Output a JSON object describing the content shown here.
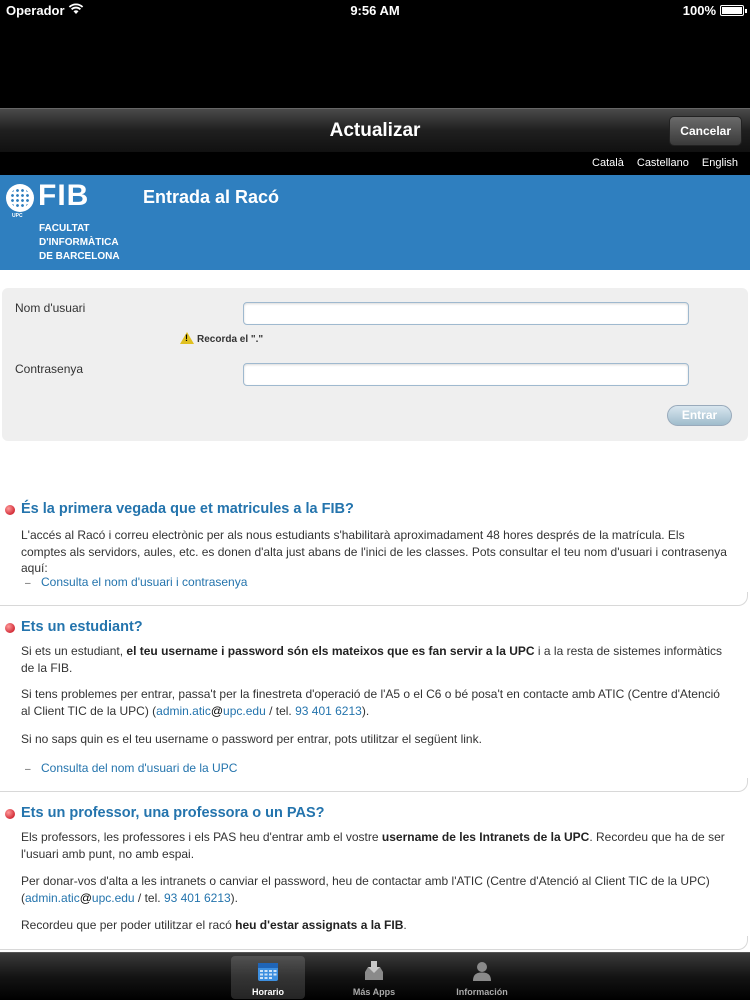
{
  "status_bar": {
    "carrier": "Operador",
    "time": "9:56 AM",
    "battery": "100%",
    "battery_level": 1.0
  },
  "nav": {
    "title": "Actualizar",
    "cancel_label": "Cancelar"
  },
  "languages": [
    "Català",
    "Castellano",
    "English"
  ],
  "header": {
    "logo_text": "FIB",
    "logo_upc": "UPC",
    "logo_lines": [
      "FACULTAT",
      "D'INFORMÀTICA",
      "DE BARCELONA"
    ],
    "title": "Entrada al Racó"
  },
  "login": {
    "username_label": "Nom d'usuari",
    "username_value": "",
    "hint": "Recorda el \".\"",
    "password_label": "Contrasenya",
    "password_value": "",
    "submit_label": "Entrar"
  },
  "sections": {
    "first_time": {
      "title": "És la primera vegada que et matricules a la FIB?",
      "body": "L'accés al Racó i correu electrònic per als nous estudiants s'habilitarà aproximadament 48 hores després de la matrícula. Els comptes als servidors, aules, etc. es donen d'alta just abans de l'inici de les classes. Pots consultar el teu nom d'usuari i contrasenya aquí:",
      "link": "Consulta el nom d'usuari i contrasenya"
    },
    "student": {
      "title": "Ets un estudiant?",
      "p1_pre": "Si ets un estudiant, ",
      "p1_bold": "el teu username i password són els mateixos que es fan servir a la UPC",
      "p1_post": " i a la resta de sistemes informàtics de la FIB.",
      "p2_pre": "Si tens problemes per entrar, passa't per la finestreta d'operació de l'A5 o el C6 o bé posa't en contacte amb ATIC (Centre d'Atenció al Client TIC de la UPC) (",
      "p2_email_user": "admin.atic",
      "p2_email_at": "@",
      "p2_email_domain": "upc.edu",
      "p2_mid": " / tel. ",
      "p2_phone": "93 401 6213",
      "p2_post": ").",
      "p3": "Si no saps quin es el teu username o password per entrar, pots utilitzar el següent link.",
      "link": "Consulta del nom d'usuari de la UPC"
    },
    "staff": {
      "title": "Ets un professor, una professora o un PAS?",
      "p1_pre": "Els professors, les professores i els PAS heu d'entrar amb el vostre ",
      "p1_bold": "username de les Intranets de la UPC",
      "p1_post": ". Recordeu que ha de ser l'usuari amb punt, no amb espai.",
      "p2_pre": "Per donar-vos d'alta a les intranets o canviar el password, heu de contactar amb l'ATIC (Centre d'Atenció al Client TIC de la UPC) (",
      "p2_email_user": "admin.atic",
      "p2_email_at": "@",
      "p2_email_domain": "upc.edu",
      "p2_mid": " / tel. ",
      "p2_phone": "93 401 6213",
      "p2_post": ").",
      "p3_pre": "Recordeu que per poder utilitzar el racó ",
      "p3_bold": "heu d'estar assignats a la FIB",
      "p3_post": "."
    }
  },
  "tabs": [
    {
      "label": "Horario",
      "icon": "calendar-icon",
      "active": true
    },
    {
      "label": "Más Apps",
      "icon": "download-tray-icon",
      "active": false
    },
    {
      "label": "Información",
      "icon": "person-icon",
      "active": false
    }
  ],
  "colors": {
    "header_blue": "#2f7fbf",
    "link_blue": "#2474ad",
    "bullet_red": "#c00010"
  }
}
